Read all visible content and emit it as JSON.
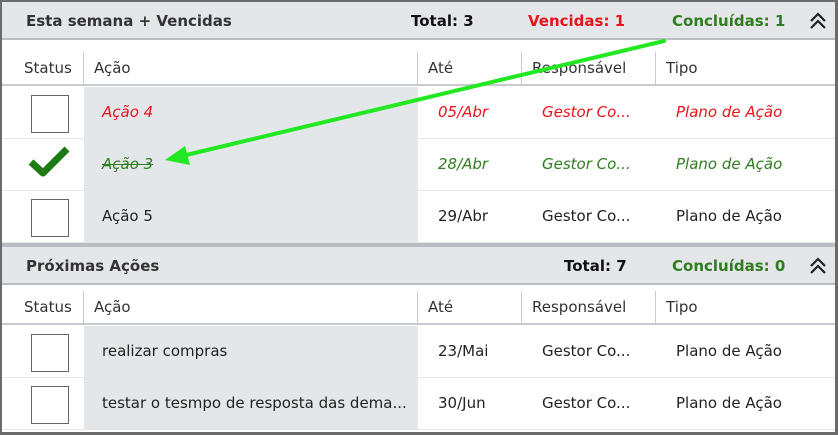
{
  "columns": [
    "Status",
    "Ação",
    "Até",
    "Responsável",
    "Tipo"
  ],
  "section1": {
    "title": "Esta semana + Vencidas",
    "total": "Total: 3",
    "vencidas": "Vencidas: 1",
    "concluidas": "Concluídas: 1",
    "rows": [
      {
        "acao": "Ação 4",
        "ate": "05/Abr",
        "responsavel": "Gestor Co...",
        "tipo": "Plano de Ação",
        "state": "overdue"
      },
      {
        "acao": "Ação 3",
        "ate": "28/Abr",
        "responsavel": "Gestor Co...",
        "tipo": "Plano de Ação",
        "state": "done"
      },
      {
        "acao": "Ação 5",
        "ate": "29/Abr",
        "responsavel": "Gestor Co...",
        "tipo": "Plano de Ação",
        "state": "open"
      }
    ]
  },
  "section2": {
    "title": "Próximas Ações",
    "total": "Total: 7",
    "concluidas": "Concluídas: 0",
    "rows": [
      {
        "acao": "realizar compras",
        "ate": "23/Mai",
        "responsavel": "Gestor Co...",
        "tipo": "Plano de Ação",
        "state": "open"
      },
      {
        "acao": "testar o tesmpo de resposta das dema...",
        "ate": "30/Jun",
        "responsavel": "Gestor Co...",
        "tipo": "Plano de Ação",
        "state": "open"
      }
    ]
  },
  "colors": {
    "overdue": "#e8141b",
    "done": "#2e7d1e",
    "annotation_arrow": "#22e822"
  },
  "icons": {
    "collapse": "double-chevron-up-icon",
    "done": "checkmark-icon",
    "arrow": "annotation-arrow"
  }
}
